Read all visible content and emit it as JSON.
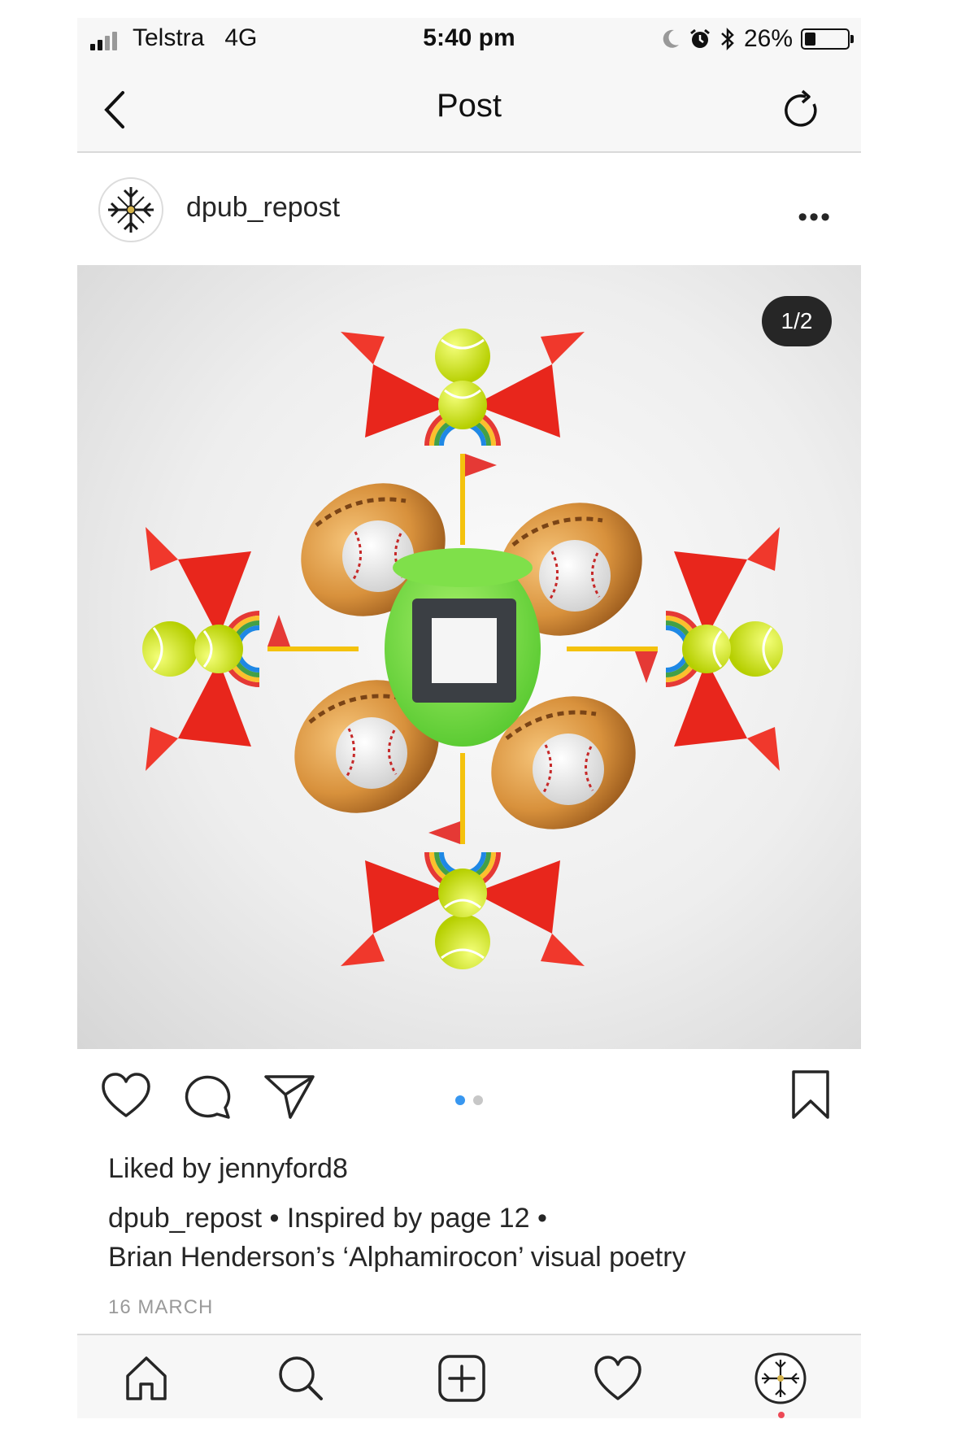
{
  "status_bar": {
    "carrier": "Telstra",
    "network": "4G",
    "time": "5:40 pm",
    "battery_percent": "26%",
    "battery_level": 0.26,
    "icons": [
      "signal-icon",
      "moon-icon",
      "alarm-icon",
      "bluetooth-icon",
      "battery-icon"
    ]
  },
  "nav": {
    "title": "Post",
    "back_icon": "chevron-left-icon",
    "refresh_icon": "refresh-icon"
  },
  "post": {
    "username": "dpub_repost",
    "more_label": "•••",
    "image_counter": "1/2",
    "carousel": {
      "count": 2,
      "active": 1
    },
    "liked_by_prefix": "Liked by ",
    "liked_by_user": "jennyford8",
    "caption_user": "dpub_repost",
    "caption_line1": " • Inspired by page 12 •",
    "caption_line2": "Brian Henderson’s ‘Alphamirocon’ visual poetry",
    "date": "16 MARCH"
  },
  "tabbar": {
    "icons": [
      "home-icon",
      "search-icon",
      "add-post-icon",
      "activity-heart-icon",
      "profile-avatar-icon"
    ]
  },
  "colors": {
    "carousel_active": "#3897f0",
    "carousel_inactive": "#c7c7c7",
    "notification_dot": "#ed4956"
  }
}
